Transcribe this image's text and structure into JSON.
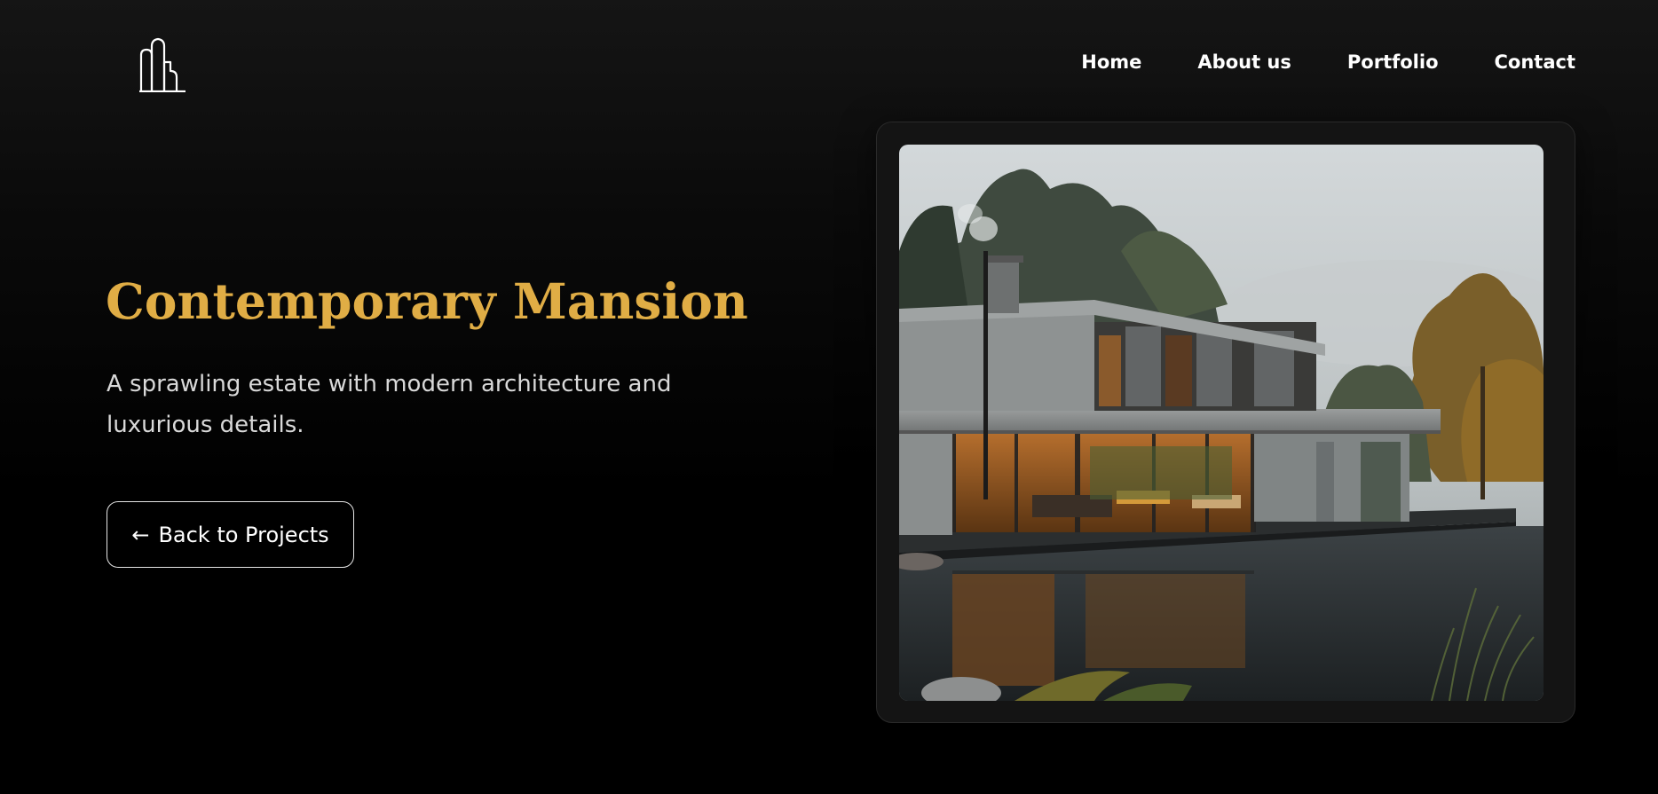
{
  "header": {
    "logo_icon": "building-outline-icon",
    "nav": [
      {
        "label": "Home"
      },
      {
        "label": "About us"
      },
      {
        "label": "Portfolio"
      },
      {
        "label": "Contact"
      }
    ]
  },
  "hero": {
    "title": "Contemporary Mansion",
    "description": "A sprawling estate with modern architecture and luxurious details.",
    "back_button": {
      "arrow": "←",
      "label": "Back to Projects"
    }
  },
  "project_image": {
    "alt": "Contemporary Mansion"
  },
  "colors": {
    "background": "#000000",
    "accent_gold": "#e0ad45",
    "text_primary": "#ffffff",
    "text_secondary": "#d9d9d9",
    "card_background": "#141414",
    "button_border": "#e6e6e6"
  }
}
